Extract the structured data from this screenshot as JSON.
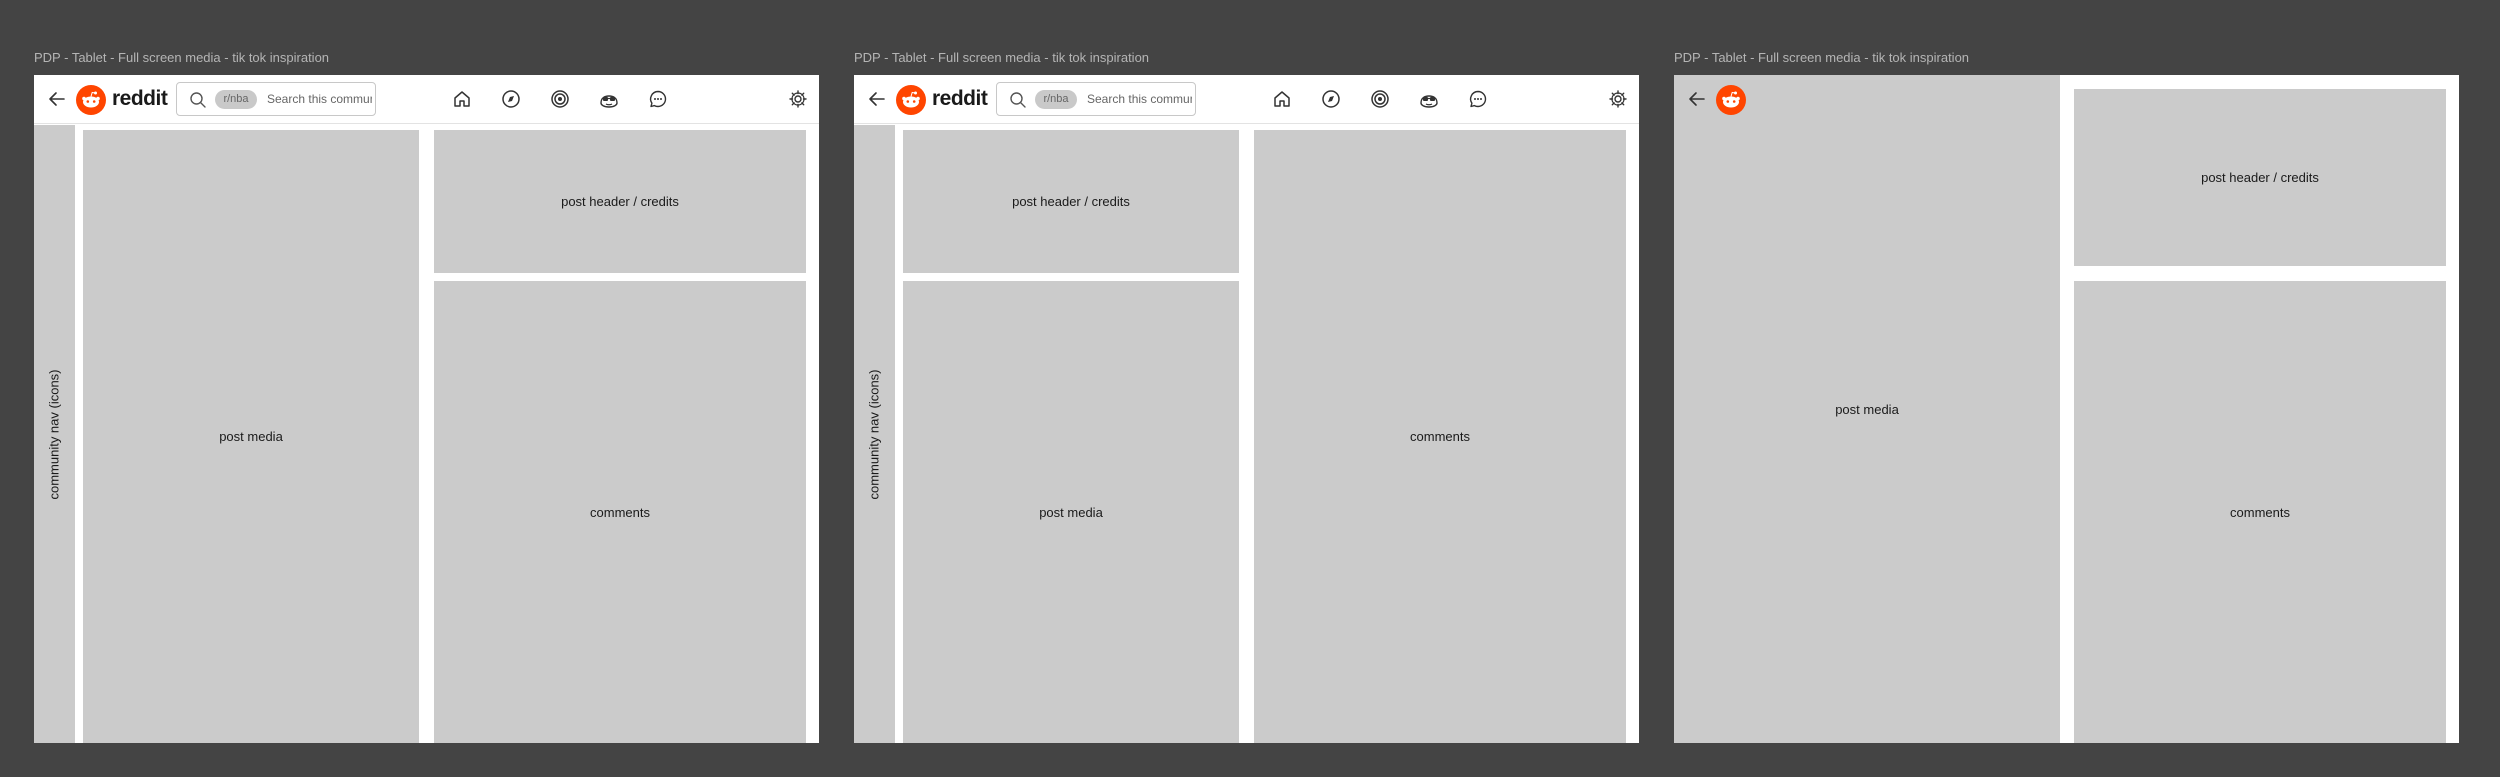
{
  "frames": [
    {
      "title": "PDP - Tablet - Full screen media - tik tok inspiration",
      "brand": "reddit",
      "search": {
        "chip": "r/nba",
        "placeholder": "Search this community"
      },
      "panels": {
        "community_nav": "community nav (icons)",
        "post_media": "post media",
        "post_header": "post header / credits",
        "comments": "comments"
      }
    },
    {
      "title": "PDP - Tablet - Full screen media - tik tok inspiration",
      "brand": "reddit",
      "search": {
        "chip": "r/nba",
        "placeholder": "Search this community"
      },
      "panels": {
        "community_nav": "community nav (icons)",
        "post_header": "post header / credits",
        "post_media": "post media",
        "comments": "comments"
      }
    },
    {
      "title": "PDP - Tablet - Full screen media - tik tok inspiration",
      "panels": {
        "post_media": "post media",
        "post_header": "post header / credits",
        "comments": "comments"
      }
    }
  ],
  "icons": {
    "back": "arrow-left-icon",
    "logo": "reddit-snoo-icon",
    "search": "search-icon",
    "home": "home-icon",
    "explore": "compass-icon",
    "popular": "target-icon",
    "avatar": "snoo-sunglasses-icon",
    "chat": "chat-bubble-icon",
    "settings": "gear-icon"
  },
  "colors": {
    "canvas": "#444444",
    "panel": "#cbcbcb",
    "brand": "#ff4500"
  }
}
